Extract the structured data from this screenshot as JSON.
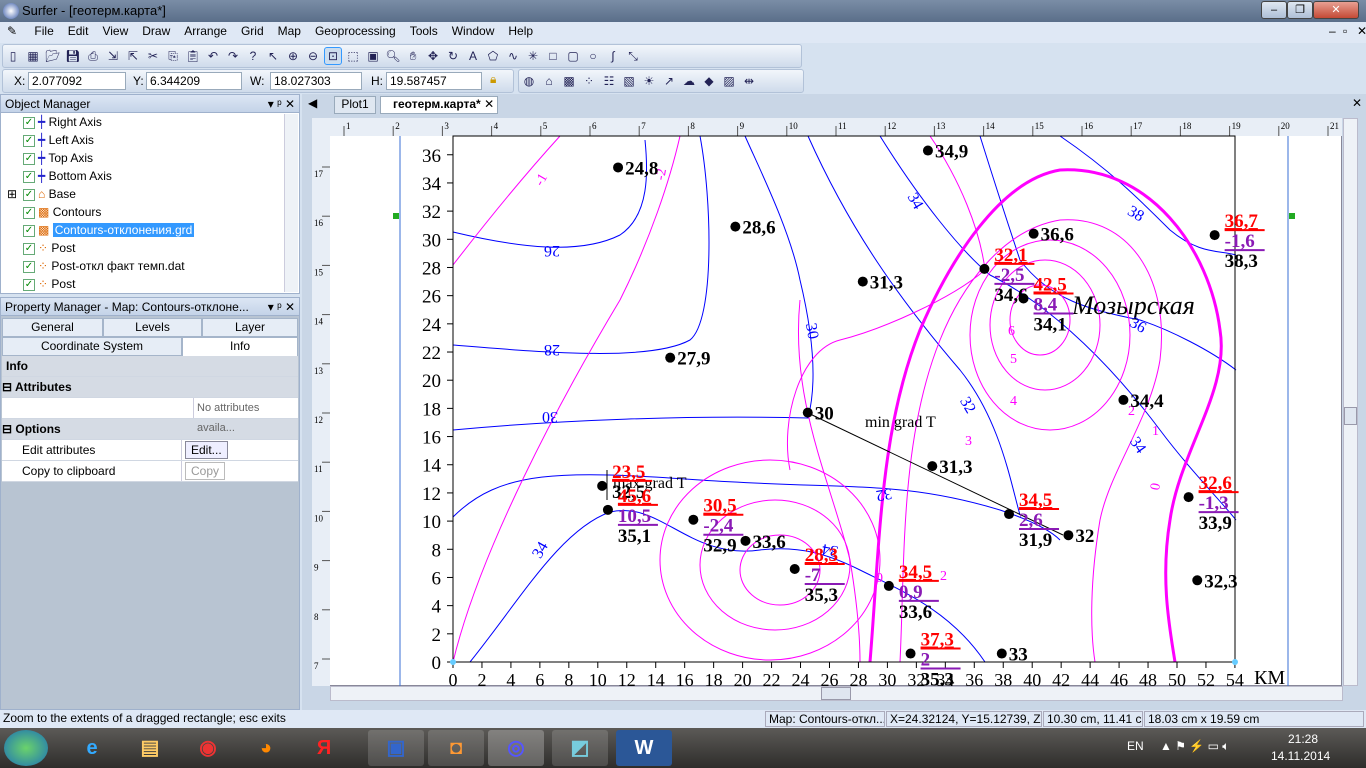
{
  "window": {
    "title": "Surfer - [геотерм.карта*]",
    "min": "‒",
    "max": "❐",
    "close": "✕"
  },
  "menu": [
    "File",
    "Edit",
    "View",
    "Draw",
    "Arrange",
    "Grid",
    "Map",
    "Geoprocessing",
    "Tools",
    "Window",
    "Help"
  ],
  "toolbar": {
    "x_label": "X:",
    "x_value": "2.077092",
    "y_label": "Y:",
    "y_value": "6.344209",
    "w_label": "W:",
    "w_value": "18.027303",
    "h_label": "H:",
    "h_value": "19.587457",
    "icons": [
      "new-plot-icon",
      "new-worksheet-icon",
      "open-icon",
      "save-icon",
      "print-icon",
      "import-icon",
      "export-icon",
      "cut-icon",
      "copy-icon",
      "paste-icon",
      "undo-icon",
      "redo-icon",
      "help-icon",
      "select-icon",
      "zoom-in-icon",
      "zoom-out-icon",
      "zoom-rectangle-icon",
      "zoom-selected-icon",
      "actual-size-icon",
      "zoom-page-icon",
      "pan-icon",
      "fit-window-icon",
      "redraw-icon",
      "text-icon",
      "polygon-icon",
      "polyline-icon",
      "symbol-icon",
      "rectangle-icon",
      "rounded-rectangle-icon",
      "ellipse-icon",
      "spline-icon",
      "reshape-icon"
    ],
    "map_icons": [
      "new-3d-surface-icon",
      "base-map-icon",
      "contour-map-icon",
      "post-map-icon",
      "classed-post-icon",
      "image-map-icon",
      "shaded-relief-icon",
      "vector-map-icon",
      "wireframe-icon",
      "watershed-icon",
      "image-icon",
      "scale-bar-icon"
    ]
  },
  "object_manager": {
    "title": "Object Manager",
    "items": [
      {
        "label": "Right Axis",
        "icon": "axis-icon",
        "checked": true
      },
      {
        "label": "Left Axis",
        "icon": "axis-icon",
        "checked": true
      },
      {
        "label": "Top Axis",
        "icon": "axis-icon",
        "checked": true
      },
      {
        "label": "Bottom Axis",
        "icon": "axis-icon",
        "checked": true
      },
      {
        "label": "Base",
        "icon": "base-map-icon",
        "checked": true,
        "expand": "+"
      },
      {
        "label": "Contours",
        "icon": "contour-map-icon",
        "checked": true
      },
      {
        "label": "Contours-отклонения.grd",
        "icon": "contour-map-icon",
        "checked": true,
        "selected": true
      },
      {
        "label": "Post",
        "icon": "post-map-icon",
        "checked": true
      },
      {
        "label": "Post-откл факт темп.dat",
        "icon": "post-map-icon",
        "checked": true
      },
      {
        "label": "Post",
        "icon": "post-map-icon",
        "checked": true
      }
    ]
  },
  "property_manager": {
    "title": "Property Manager - Map: Contours-отклоне...",
    "tabs_row1": [
      "General",
      "Levels",
      "Layer"
    ],
    "tabs_row2": [
      "Coordinate System",
      "Info"
    ],
    "active_tab": "Info",
    "section": "Info",
    "attributes_label": "Attributes",
    "attributes_value": "No attributes availa...",
    "options_label": "Options",
    "edit_label": "Edit attributes",
    "edit_button": "Edit...",
    "copy_label": "Copy to clipboard",
    "copy_button": "Copy"
  },
  "doc_tabs": [
    "Plot1",
    "геотерм.карта*"
  ],
  "map": {
    "x_ticks": [
      0,
      2,
      4,
      6,
      8,
      10,
      12,
      14,
      16,
      18,
      20,
      22,
      24,
      26,
      28,
      30,
      32,
      34,
      36,
      38,
      40,
      42,
      44,
      46,
      48,
      50,
      52,
      54
    ],
    "y_ticks": [
      0,
      2,
      4,
      6,
      8,
      10,
      12,
      14,
      16,
      18,
      20,
      22,
      24,
      26,
      28,
      30,
      32,
      34,
      36
    ],
    "x_unit": "КМ",
    "ruler_top": [
      1,
      2,
      3,
      4,
      5,
      6,
      7,
      8,
      9,
      10,
      11,
      12,
      13,
      14,
      15,
      16,
      17,
      18,
      19,
      20,
      21
    ],
    "ruler_left": [
      17,
      16,
      15,
      14,
      13,
      12,
      11,
      10,
      9,
      8,
      7
    ],
    "place_label": "Мозырская",
    "annotations": {
      "min_grad": "min grad T",
      "max_grad": "max grad T"
    },
    "colors": {
      "isotherm": "#0000ff",
      "deviation": "#ff00ff",
      "measured": "#ff0000",
      "deviation_value": "#8a1ab5",
      "model": "#000000"
    },
    "blue_contour_labels": [
      "26",
      "28",
      "30",
      "32",
      "34",
      "34",
      "34",
      "36",
      "38",
      "32",
      "34",
      "30"
    ],
    "magenta_contour_labels": [
      "-1",
      "-2",
      "0",
      "2",
      "3",
      "4",
      "5",
      "6",
      "1",
      "2",
      "0"
    ],
    "wells": [
      {
        "x": 11.4,
        "y": 35.1,
        "value": "24,8"
      },
      {
        "x": 19.5,
        "y": 30.9,
        "value": "28,6"
      },
      {
        "x": 28.3,
        "y": 27.0,
        "value": "31,3"
      },
      {
        "x": 15.0,
        "y": 21.6,
        "value": "27,9"
      },
      {
        "x": 24.5,
        "y": 17.7,
        "value": "30"
      },
      {
        "x": 33.1,
        "y": 13.9,
        "value": "31,3"
      },
      {
        "x": 10.3,
        "y": 12.5,
        "measured": "23,5",
        "value": "32,5"
      },
      {
        "x": 10.7,
        "y": 10.8,
        "measured": "45,6",
        "deviation": "10,5",
        "value": "35,1"
      },
      {
        "x": 16.6,
        "y": 10.1,
        "measured": "30,5",
        "deviation": "-2,4",
        "value": "32,9"
      },
      {
        "x": 20.2,
        "y": 8.6,
        "value": "33,6"
      },
      {
        "x": 23.6,
        "y": 6.6,
        "measured": "28,3",
        "deviation": "-7",
        "value": "35,3"
      },
      {
        "x": 30.1,
        "y": 5.4,
        "measured": "34,5",
        "deviation": "0,9",
        "value": "33,6"
      },
      {
        "x": 31.6,
        "y": 0.6,
        "measured": "37,3",
        "deviation": "2",
        "value": "35,3"
      },
      {
        "x": 37.9,
        "y": 0.6,
        "value": "33"
      },
      {
        "x": 32.8,
        "y": 36.3,
        "value": "34,9"
      },
      {
        "x": 36.7,
        "y": 27.9,
        "measured": "32,1",
        "deviation": "-2,5",
        "value": "34,6"
      },
      {
        "x": 40.1,
        "y": 30.4,
        "value": "36,6"
      },
      {
        "x": 39.4,
        "y": 25.8,
        "measured": "42,5",
        "deviation": "8,4",
        "value": "34,1"
      },
      {
        "x": 52.6,
        "y": 30.3,
        "measured": "36,7",
        "deviation": "-1,6",
        "value": "38,3"
      },
      {
        "x": 46.3,
        "y": 18.6,
        "value": "34,4"
      },
      {
        "x": 38.4,
        "y": 10.5,
        "measured": "34,5",
        "deviation": "2,6",
        "value": "31,9"
      },
      {
        "x": 42.5,
        "y": 9.0,
        "value": "32"
      },
      {
        "x": 50.8,
        "y": 11.7,
        "measured": "32,6",
        "deviation": "-1,3",
        "value": "33,9"
      },
      {
        "x": 51.4,
        "y": 5.8,
        "value": "32,3"
      }
    ]
  },
  "status": {
    "hint": "Zoom to the extents of a dragged rectangle; esc exits",
    "object": "Map: Contours-откл...",
    "xyz": "X=24.32124, Y=15.12739, Z=30.91472",
    "cursor": "10.30 cm, 11.41 cm",
    "size": "18.03 cm x 19.59 cm"
  },
  "taskbar": {
    "lang": "EN",
    "time": "21:28",
    "date": "14.11.2014",
    "apps": [
      "start-button",
      "internet-explorer",
      "file-explorer",
      "chrome",
      "firefox",
      "yandex-browser",
      "save-app",
      "paint-app",
      "surfer-app",
      "notes-app",
      "word-app"
    ]
  }
}
